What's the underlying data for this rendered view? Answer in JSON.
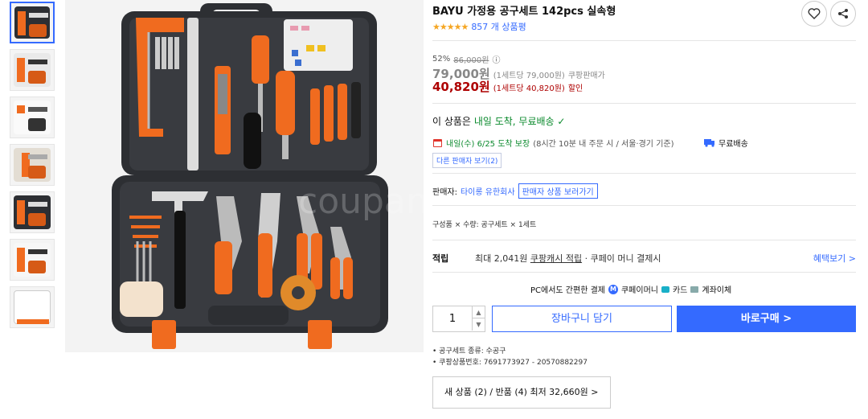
{
  "product": {
    "title": "BAYU 가정용 공구세트 142pcs 실속형",
    "stars": "★★★★★",
    "review_count": "857 개 상품평",
    "image_watermark": "coupang"
  },
  "price": {
    "discount_rate": "52%",
    "original_price": "86,000원",
    "info_icon": "ⓘ",
    "sale_price": "79,000원",
    "sale_unit": "(1세트당 79,000원)",
    "sale_label": "쿠팡판매가",
    "final_price": "40,820원",
    "final_unit": "(1세트당 40,820원)",
    "final_label": "할인"
  },
  "shipping": {
    "prefix": "이 상품은",
    "highlight": "내일 도착, 무료배송",
    "check": "✓",
    "eta_date": "내일(수) 6/25 도착 보장",
    "eta_note": "(8시간 10분 내 주문 시 / 서울·경기 기준)",
    "free_label": "무료배송",
    "other_sellers": "다른 판매자 보기(2)"
  },
  "seller": {
    "label": "판매자:",
    "name": "타이롱 유한회사",
    "button": "판매자 상품 보러가기"
  },
  "config": "구성품 × 수량: 공구세트 × 1세트",
  "reward": {
    "label": "적립",
    "text_a": "최대 2,041원",
    "text_b": "쿠팡캐시 적립",
    "text_c": "· 쿠페이 머니 결제시",
    "more": "혜택보기 >"
  },
  "payment": {
    "pc_label": "PC에서도 간편한 결제",
    "money": "쿠페이머니",
    "card": "카드",
    "bank": "계좌이체"
  },
  "purchase": {
    "quantity": "1",
    "cart_label": "장바구니 담기",
    "buy_label": "바로구매 >"
  },
  "attributes": [
    "공구세트 종류: 수공구",
    "쿠팡상품번호: 7691773927 - 20570882297"
  ],
  "offers": "새 상품 (2) / 반품 (4) 최저 32,660원  >",
  "colors": {
    "accent": "#346aff",
    "sale_red": "#ae0000",
    "ship_green": "#0b8a2d",
    "toolcase": "#2d2f33",
    "tool_orange": "#f06b1f"
  }
}
